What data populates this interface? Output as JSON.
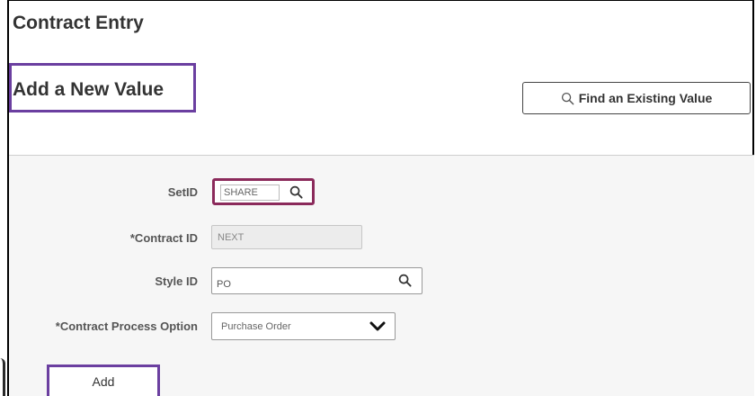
{
  "header": {
    "page_title": "Contract Entry",
    "subtitle": "Add a New Value",
    "find_existing_label": "Find an Existing Value"
  },
  "form": {
    "setid": {
      "label": "SetID",
      "value": "SHARE"
    },
    "contract_id": {
      "label": "*Contract ID",
      "value": "NEXT"
    },
    "style_id": {
      "label": "Style ID",
      "value": "PO"
    },
    "process_option": {
      "label": "*Contract Process Option",
      "value": "Purchase Order"
    }
  },
  "actions": {
    "add_label": "Add"
  },
  "icons": {
    "lookup": "magnifier-icon",
    "dropdown": "chevron-down-icon"
  },
  "colors": {
    "highlight_purple": "#6b3fa0",
    "highlight_magenta": "#8b2a5b",
    "form_background": "#f6f6f6"
  }
}
